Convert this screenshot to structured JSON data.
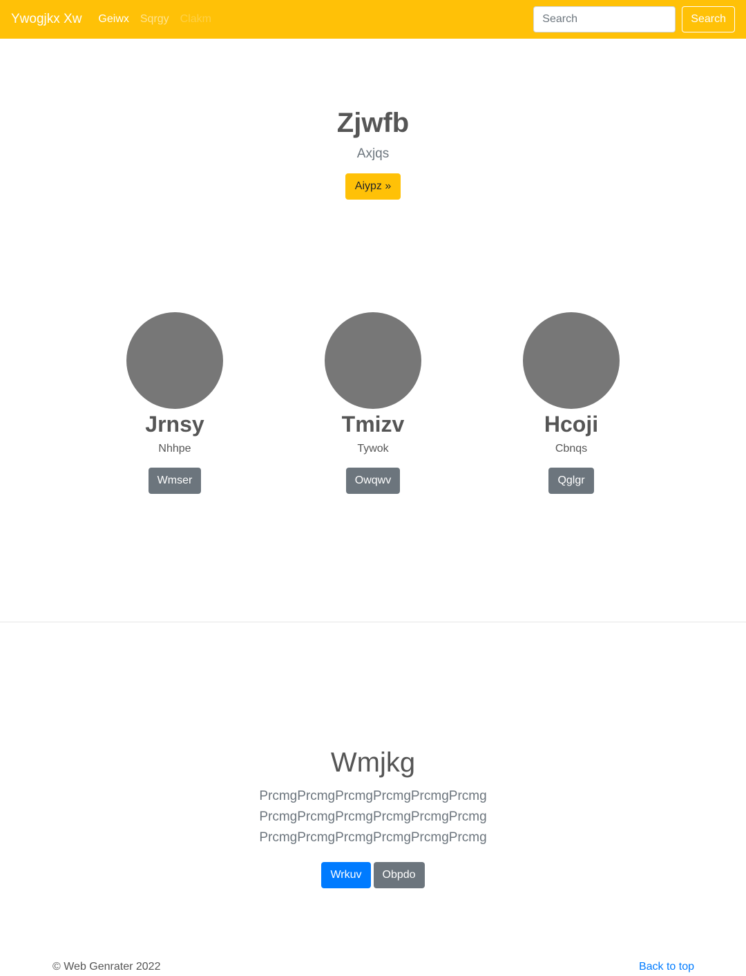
{
  "navbar": {
    "brand": "Ywogjkx Xw",
    "links": [
      "Geiwx",
      "Sqrgy",
      "Clakm"
    ],
    "search_placeholder": "Search",
    "search_button": "Search"
  },
  "hero": {
    "title": "Zjwfb",
    "subtitle": "Axjqs",
    "button": "Aiypz »"
  },
  "team": [
    {
      "name": "Jrnsy",
      "role": "Nhhpe",
      "button": "Wmser"
    },
    {
      "name": "Tmizv",
      "role": "Tywok",
      "button": "Owqwv"
    },
    {
      "name": "Hcoji",
      "role": "Cbnqs",
      "button": "Qglgr"
    }
  ],
  "promo": {
    "title": "Wmjkg",
    "text": "PrcmgPrcmgPrcmgPrcmgPrcmgPrcmgPrcmgPrcmgPrcmgPrcmgPrcmgPrcmgPrcmgPrcmgPrcmgPrcmgPrcmgPrcmg",
    "primary_button": "Wrkuv",
    "secondary_button": "Obpdo"
  },
  "footer": {
    "copyright": "© Web Genrater 2022",
    "back_to_top": "Back to top"
  }
}
